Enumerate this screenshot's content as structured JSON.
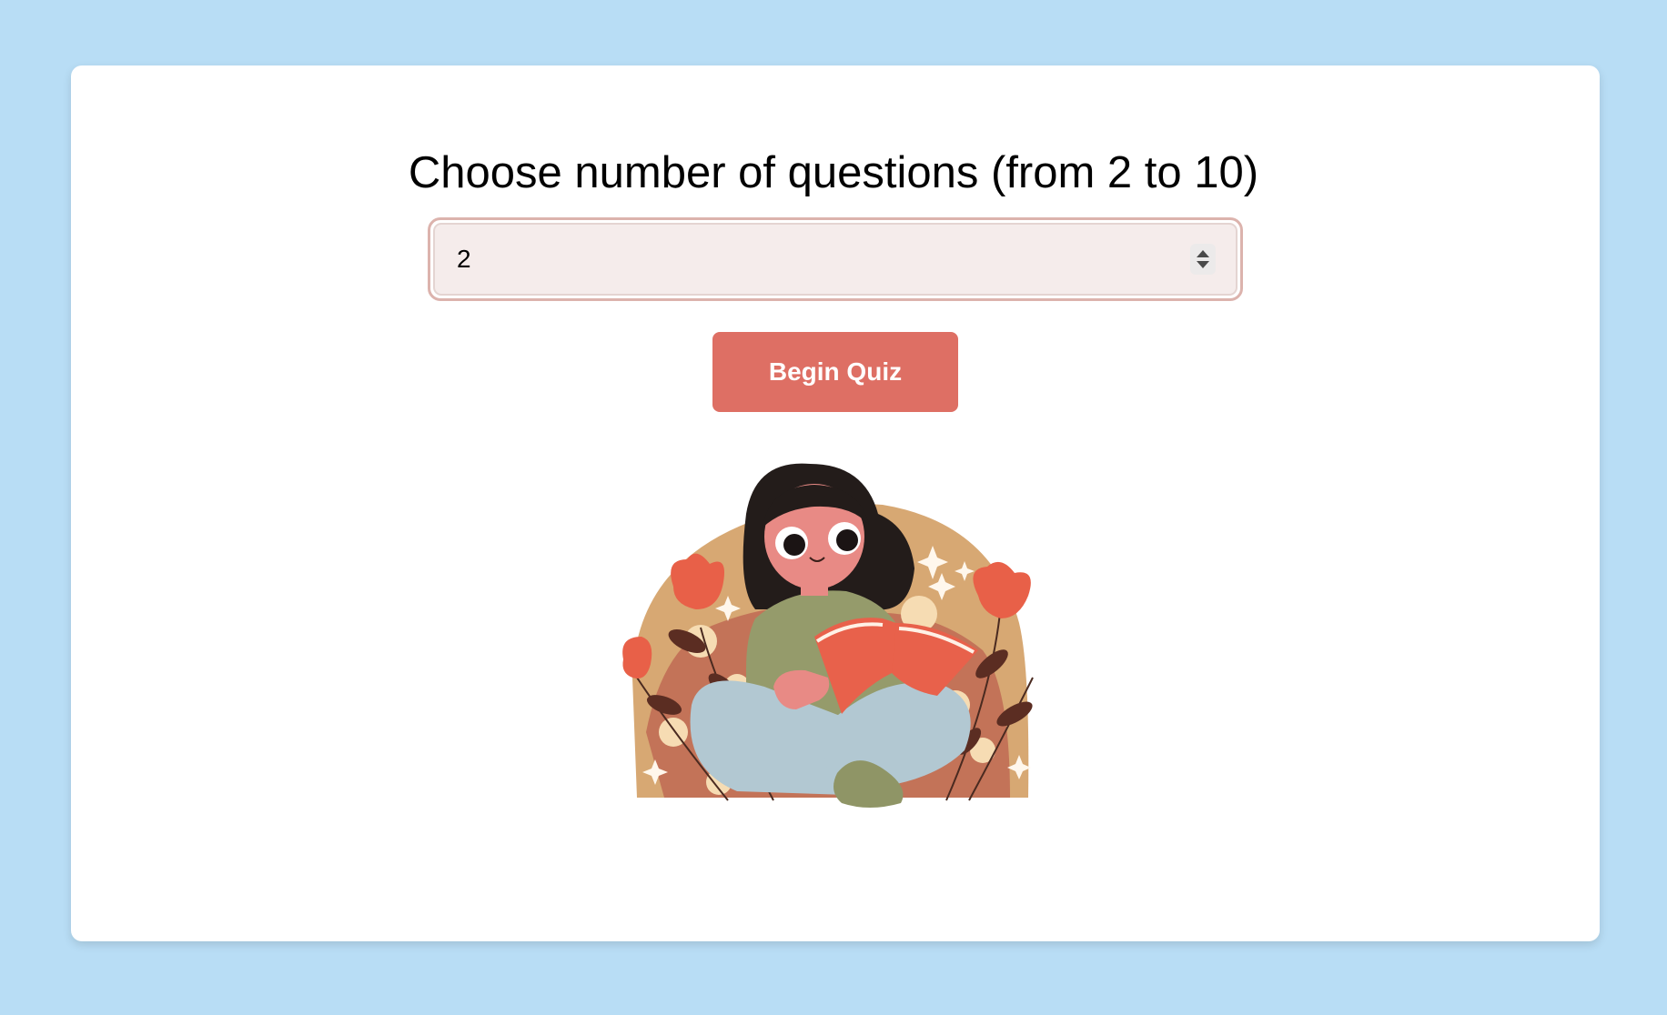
{
  "heading": "Choose number of questions (from 2 to 10)",
  "question_count_input": {
    "value": "2",
    "min": "2",
    "max": "10"
  },
  "begin_button_label": "Begin Quiz",
  "illustration": {
    "icon": "girl-reading-book-illustration"
  },
  "colors": {
    "page_background": "#b8ddf5",
    "card_background": "#ffffff",
    "button": "#de6f64",
    "input_fill": "#f5eceb",
    "input_border": "#dcb3ad"
  }
}
